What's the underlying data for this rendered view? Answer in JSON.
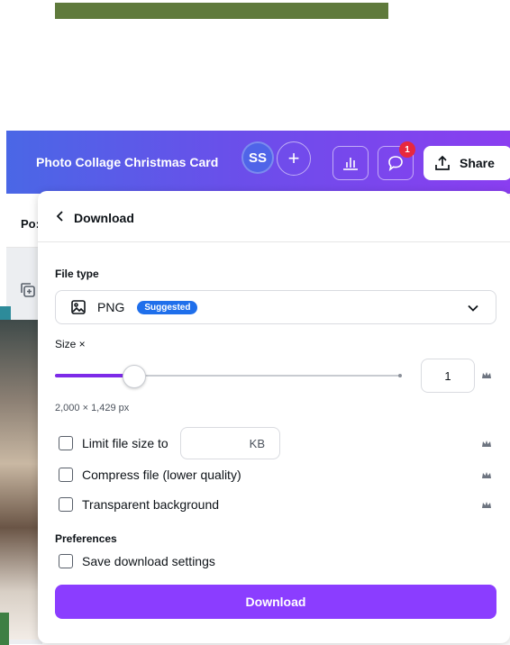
{
  "header": {
    "title": "Photo Collage Christmas Card",
    "avatar_initials": "SS",
    "add_symbol": "+",
    "comments_badge": "1",
    "share_label": "Share"
  },
  "background": {
    "tab_text": "Po:"
  },
  "download_panel": {
    "title": "Download",
    "file_type_label": "File type",
    "file_type_value": "PNG",
    "suggested_badge": "Suggested",
    "size_label": "Size ×",
    "size_value": "1",
    "size_fraction": 0.23,
    "dimensions": "2,000 × 1,429 px",
    "options": {
      "limit_file_size": "Limit file size to",
      "kb_unit": "KB",
      "compress": "Compress file (lower quality)",
      "transparent": "Transparent background"
    },
    "preferences_label": "Preferences",
    "save_settings": "Save download settings",
    "download_button": "Download"
  },
  "colors": {
    "accent": "#8b3dff",
    "badge": "#e8283e",
    "suggested": "#1f6feb"
  }
}
